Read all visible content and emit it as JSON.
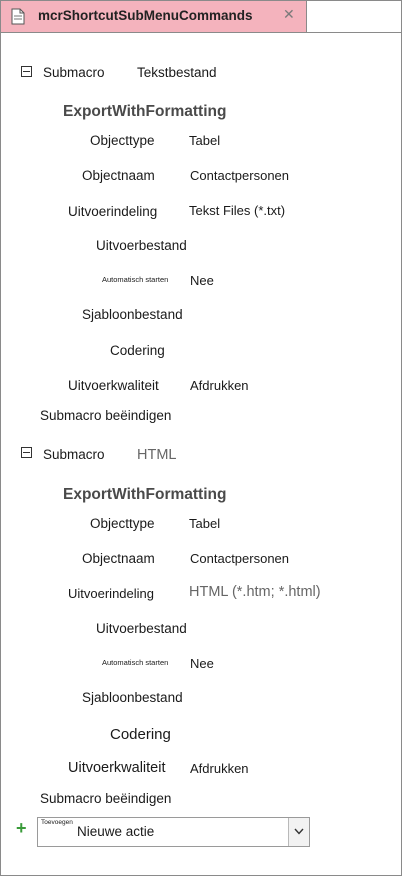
{
  "tab": {
    "title": "mcrShortcutSubMenuCommands",
    "close_glyph": "✕",
    "icon": "macro-doc-icon"
  },
  "blocks": [
    {
      "submacro_label": "Submacro",
      "submacro_name": "Tekstbestand",
      "action": "ExportWithFormatting",
      "fields": {
        "objecttype": {
          "label": "Objecttype",
          "value": "Tabel"
        },
        "objectnaam": {
          "label": "Objectnaam",
          "value": "Contactpersonen"
        },
        "uitvoerindeling": {
          "label": "Uitvoerindeling",
          "value": "Tekst Files (*.txt)"
        },
        "uitvoerbestand": {
          "label": "Uitvoerbestand",
          "value": ""
        },
        "automatisch": {
          "label": "Automatisch starten",
          "value": "Nee"
        },
        "sjabloon": {
          "label": "Sjabloonbestand",
          "value": ""
        },
        "codering": {
          "label": "Codering",
          "value": ""
        },
        "kwaliteit": {
          "label": "Uitvoerkwaliteit",
          "value": "Afdrukken"
        }
      },
      "end_label": "Submacro beëindigen"
    },
    {
      "submacro_label": "Submacro",
      "submacro_name": "HTML",
      "action": "ExportWithFormatting",
      "fields": {
        "objecttype": {
          "label": "Objecttype",
          "value": "Tabel"
        },
        "objectnaam": {
          "label": "Objectnaam",
          "value": "Contactpersonen"
        },
        "uitvoerindeling": {
          "label": "Uitvoerindeling",
          "value": "HTML (*.htm; *.html)"
        },
        "uitvoerbestand": {
          "label": "Uitvoerbestand",
          "value": ""
        },
        "automatisch": {
          "label": "Automatisch starten",
          "value": "Nee"
        },
        "sjabloon": {
          "label": "Sjabloonbestand",
          "value": ""
        },
        "codering": {
          "label": "Codering",
          "value": ""
        },
        "kwaliteit": {
          "label": "Uitvoerkwaliteit",
          "value": "Afdrukken"
        }
      },
      "end_label": "Submacro beëindigen"
    }
  ],
  "add_action": {
    "tag": "Toevoegen",
    "value": "Nieuwe actie",
    "plus_icon": "plus-icon",
    "dropdown_icon": "chevron-down-icon"
  },
  "colors": {
    "tab_bg": "#f4b3bd",
    "plus": "#3a9b3a"
  }
}
